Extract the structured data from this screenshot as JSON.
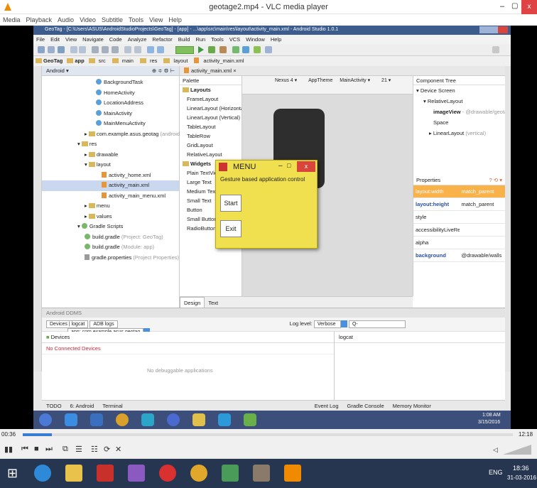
{
  "vlc": {
    "title": "geotage2.mp4 - VLC media player",
    "menu": [
      "Media",
      "Playback",
      "Audio",
      "Video",
      "Subtitle",
      "Tools",
      "View",
      "Help"
    ],
    "time_left": "00:36",
    "time_right": "12:18",
    "progress": 0.06
  },
  "as": {
    "title": "GeoTag - [C:\\Users\\ASUS\\AndroidStudioProjects\\GeoTag] - [app] - ...\\app\\src\\main\\res\\layout\\activity_main.xml - Android Studio 1.0.1",
    "menu": [
      "File",
      "Edit",
      "View",
      "Navigate",
      "Code",
      "Analyze",
      "Refactor",
      "Build",
      "Run",
      "Tools",
      "VCS",
      "Window",
      "Help"
    ],
    "crumbs": [
      "GeoTag",
      "app",
      "src",
      "main",
      "res",
      "layout",
      "activity_main.xml"
    ],
    "project_mode": "Android",
    "tree": [
      "BackgroundTask",
      "HomeActivity",
      "LocationAddress",
      "MainActivity",
      "MainMenuActivity",
      "com.example.asus.geotag",
      "res",
      "drawable",
      "layout",
      "activity_home.xml",
      "activity_main.xml",
      "activity_main_menu.xml",
      "menu",
      "values",
      "Gradle Scripts",
      "build.gradle",
      "build.gradle",
      "gradle.properties"
    ],
    "tree_notes": [
      "(androidTest)",
      "(Project: GeoTag)",
      "(Module: app)",
      "(Project Properties)"
    ],
    "editor_tab": "activity_main.xml",
    "palette_header": "Palette",
    "palette_layouts": "Layouts",
    "palette_items": [
      "FrameLayout",
      "LinearLayout (Horizontal)",
      "LinearLayout (Vertical)",
      "TableLayout",
      "TableRow",
      "GridLayout",
      "RelativeLayout"
    ],
    "palette_widgets": "Widgets",
    "widget_items": [
      "Plain TextView",
      "Large Text",
      "Medium Text",
      "Small Text",
      "Button",
      "Small Button",
      "RadioButton"
    ],
    "design_tab": "Design",
    "text_tab": "Text",
    "toolbar_device": "Nexus 4",
    "toolbar_theme": "AppTheme",
    "toolbar_activity": "MainActivity",
    "toolbar_api": "21",
    "comp_tree_title": "Component Tree",
    "comp_tree": [
      "Device Screen",
      "RelativeLayout",
      "imageView",
      "Space",
      "LinearLayout"
    ],
    "comp_notes": [
      "- @drawable/geotagr",
      "(vertical)"
    ],
    "props_title": "Properties",
    "props": [
      [
        "layout:width",
        "match_parent"
      ],
      [
        "layout:height",
        "match_parent"
      ],
      [
        "style",
        ""
      ],
      [
        "accessibilityLiveRegion",
        ""
      ],
      [
        "alpha",
        ""
      ],
      [
        "background",
        "@drawable/walls"
      ]
    ],
    "ddms_title": "Android DDMS",
    "ddms_tab": "Devices | logcat",
    "adb": "ADB logs",
    "devices_label": "Devices",
    "no_devices": "No Connected Devices",
    "no_debug": "No debuggable applications",
    "log_level_label": "Log level:",
    "log_level": "Verbose",
    "search": "Q-",
    "app_filter": "app: com.example.asus.geotag",
    "logcat": "logcat",
    "bottom_tabs": [
      "TODO",
      "6: Android",
      "Terminal"
    ],
    "bottom_right": [
      "Event Log",
      "Gradle Console",
      "Memory Monitor"
    ],
    "right_strip": [
      "Commander",
      "Maven Projects",
      "Gradle"
    ],
    "left_strip": [
      "1: Project",
      "7: Structure",
      "Build Variants",
      "2: Favorites"
    ],
    "inner_clock": "1:08 AM",
    "inner_date": "3/15/2016",
    "inner_status": "n/a  n/a"
  },
  "dialog": {
    "title": "MENU",
    "label": "Gesture based application control",
    "start": "Start",
    "exit": "Exit"
  },
  "taskbar": {
    "lang": "ENG",
    "time": "18:36",
    "date": "31-03-2016"
  }
}
